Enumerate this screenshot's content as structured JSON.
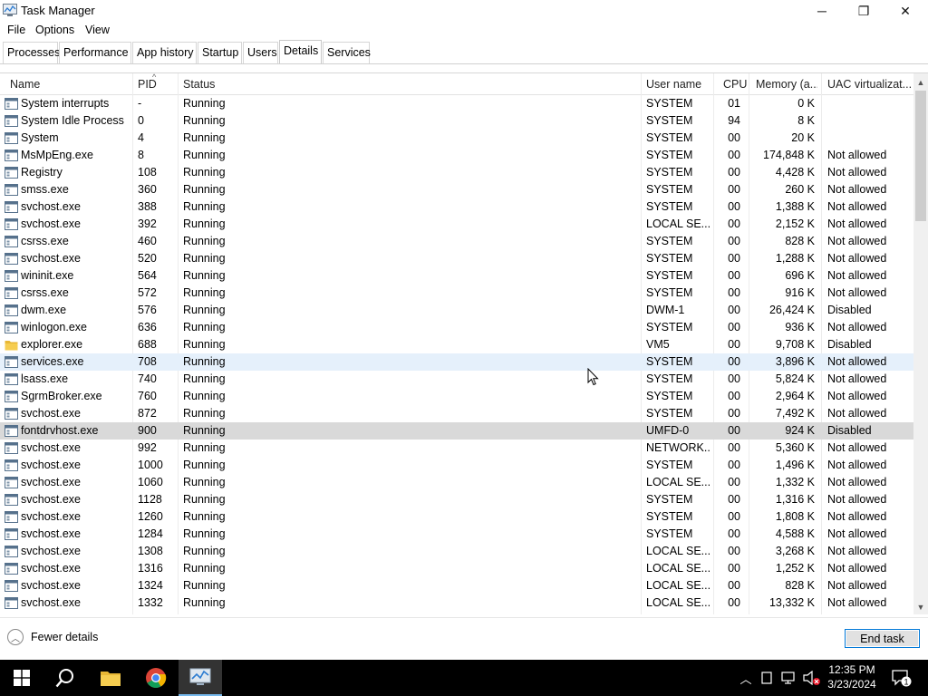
{
  "window": {
    "title": "Task Manager",
    "minimize_label": "─",
    "maximize_label": "❐",
    "close_label": "✕"
  },
  "menu": [
    "File",
    "Options",
    "View"
  ],
  "tabs": [
    {
      "label": "Processes",
      "active": false
    },
    {
      "label": "Performance",
      "active": false
    },
    {
      "label": "App history",
      "active": false
    },
    {
      "label": "Startup",
      "active": false
    },
    {
      "label": "Users",
      "active": false
    },
    {
      "label": "Details",
      "active": true
    },
    {
      "label": "Services",
      "active": false
    }
  ],
  "columns": {
    "name": "Name",
    "pid": "PID",
    "status": "Status",
    "user": "User name",
    "cpu": "CPU",
    "memory": "Memory (a...",
    "uac": "UAC virtualizat...",
    "sort_indicator": "^"
  },
  "rows": [
    {
      "name": "System interrupts",
      "pid": "-",
      "status": "Running",
      "user": "SYSTEM",
      "cpu": "01",
      "memory": "0 K",
      "uac": "",
      "icon": "process-icon"
    },
    {
      "name": "System Idle Process",
      "pid": "0",
      "status": "Running",
      "user": "SYSTEM",
      "cpu": "94",
      "memory": "8 K",
      "uac": "",
      "icon": "process-icon"
    },
    {
      "name": "System",
      "pid": "4",
      "status": "Running",
      "user": "SYSTEM",
      "cpu": "00",
      "memory": "20 K",
      "uac": "",
      "icon": "process-icon"
    },
    {
      "name": "MsMpEng.exe",
      "pid": "8",
      "status": "Running",
      "user": "SYSTEM",
      "cpu": "00",
      "memory": "174,848 K",
      "uac": "Not allowed",
      "icon": "process-icon"
    },
    {
      "name": "Registry",
      "pid": "108",
      "status": "Running",
      "user": "SYSTEM",
      "cpu": "00",
      "memory": "4,428 K",
      "uac": "Not allowed",
      "icon": "process-icon"
    },
    {
      "name": "smss.exe",
      "pid": "360",
      "status": "Running",
      "user": "SYSTEM",
      "cpu": "00",
      "memory": "260 K",
      "uac": "Not allowed",
      "icon": "process-icon"
    },
    {
      "name": "svchost.exe",
      "pid": "388",
      "status": "Running",
      "user": "SYSTEM",
      "cpu": "00",
      "memory": "1,388 K",
      "uac": "Not allowed",
      "icon": "process-icon"
    },
    {
      "name": "svchost.exe",
      "pid": "392",
      "status": "Running",
      "user": "LOCAL SE...",
      "cpu": "00",
      "memory": "2,152 K",
      "uac": "Not allowed",
      "icon": "process-icon"
    },
    {
      "name": "csrss.exe",
      "pid": "460",
      "status": "Running",
      "user": "SYSTEM",
      "cpu": "00",
      "memory": "828 K",
      "uac": "Not allowed",
      "icon": "process-icon"
    },
    {
      "name": "svchost.exe",
      "pid": "520",
      "status": "Running",
      "user": "SYSTEM",
      "cpu": "00",
      "memory": "1,288 K",
      "uac": "Not allowed",
      "icon": "process-icon"
    },
    {
      "name": "wininit.exe",
      "pid": "564",
      "status": "Running",
      "user": "SYSTEM",
      "cpu": "00",
      "memory": "696 K",
      "uac": "Not allowed",
      "icon": "process-icon"
    },
    {
      "name": "csrss.exe",
      "pid": "572",
      "status": "Running",
      "user": "SYSTEM",
      "cpu": "00",
      "memory": "916 K",
      "uac": "Not allowed",
      "icon": "process-icon"
    },
    {
      "name": "dwm.exe",
      "pid": "576",
      "status": "Running",
      "user": "DWM-1",
      "cpu": "00",
      "memory": "26,424 K",
      "uac": "Disabled",
      "icon": "process-icon"
    },
    {
      "name": "winlogon.exe",
      "pid": "636",
      "status": "Running",
      "user": "SYSTEM",
      "cpu": "00",
      "memory": "936 K",
      "uac": "Not allowed",
      "icon": "process-icon"
    },
    {
      "name": "explorer.exe",
      "pid": "688",
      "status": "Running",
      "user": "VM5",
      "cpu": "00",
      "memory": "9,708 K",
      "uac": "Disabled",
      "icon": "folder-icon"
    },
    {
      "name": "services.exe",
      "pid": "708",
      "status": "Running",
      "user": "SYSTEM",
      "cpu": "00",
      "memory": "3,896 K",
      "uac": "Not allowed",
      "icon": "process-icon",
      "state": "hover"
    },
    {
      "name": "lsass.exe",
      "pid": "740",
      "status": "Running",
      "user": "SYSTEM",
      "cpu": "00",
      "memory": "5,824 K",
      "uac": "Not allowed",
      "icon": "process-icon"
    },
    {
      "name": "SgrmBroker.exe",
      "pid": "760",
      "status": "Running",
      "user": "SYSTEM",
      "cpu": "00",
      "memory": "2,964 K",
      "uac": "Not allowed",
      "icon": "process-icon"
    },
    {
      "name": "svchost.exe",
      "pid": "872",
      "status": "Running",
      "user": "SYSTEM",
      "cpu": "00",
      "memory": "7,492 K",
      "uac": "Not allowed",
      "icon": "process-icon"
    },
    {
      "name": "fontdrvhost.exe",
      "pid": "900",
      "status": "Running",
      "user": "UMFD-0",
      "cpu": "00",
      "memory": "924 K",
      "uac": "Disabled",
      "icon": "process-icon",
      "state": "selected"
    },
    {
      "name": "svchost.exe",
      "pid": "992",
      "status": "Running",
      "user": "NETWORK...",
      "cpu": "00",
      "memory": "5,360 K",
      "uac": "Not allowed",
      "icon": "process-icon"
    },
    {
      "name": "svchost.exe",
      "pid": "1000",
      "status": "Running",
      "user": "SYSTEM",
      "cpu": "00",
      "memory": "1,496 K",
      "uac": "Not allowed",
      "icon": "process-icon"
    },
    {
      "name": "svchost.exe",
      "pid": "1060",
      "status": "Running",
      "user": "LOCAL SE...",
      "cpu": "00",
      "memory": "1,332 K",
      "uac": "Not allowed",
      "icon": "process-icon"
    },
    {
      "name": "svchost.exe",
      "pid": "1128",
      "status": "Running",
      "user": "SYSTEM",
      "cpu": "00",
      "memory": "1,316 K",
      "uac": "Not allowed",
      "icon": "process-icon"
    },
    {
      "name": "svchost.exe",
      "pid": "1260",
      "status": "Running",
      "user": "SYSTEM",
      "cpu": "00",
      "memory": "1,808 K",
      "uac": "Not allowed",
      "icon": "process-icon"
    },
    {
      "name": "svchost.exe",
      "pid": "1284",
      "status": "Running",
      "user": "SYSTEM",
      "cpu": "00",
      "memory": "4,588 K",
      "uac": "Not allowed",
      "icon": "process-icon"
    },
    {
      "name": "svchost.exe",
      "pid": "1308",
      "status": "Running",
      "user": "LOCAL SE...",
      "cpu": "00",
      "memory": "3,268 K",
      "uac": "Not allowed",
      "icon": "process-icon"
    },
    {
      "name": "svchost.exe",
      "pid": "1316",
      "status": "Running",
      "user": "LOCAL SE...",
      "cpu": "00",
      "memory": "1,252 K",
      "uac": "Not allowed",
      "icon": "process-icon"
    },
    {
      "name": "svchost.exe",
      "pid": "1324",
      "status": "Running",
      "user": "LOCAL SE...",
      "cpu": "00",
      "memory": "828 K",
      "uac": "Not allowed",
      "icon": "process-icon"
    },
    {
      "name": "svchost.exe",
      "pid": "1332",
      "status": "Running",
      "user": "LOCAL SE...",
      "cpu": "00",
      "memory": "13,332 K",
      "uac": "Not allowed",
      "icon": "process-icon"
    }
  ],
  "footer": {
    "fewer_details": "Fewer details",
    "end_task": "End task"
  },
  "taskbar": {
    "time": "12:35 PM",
    "date": "3/23/2024",
    "notification_count": "1"
  },
  "colors": {
    "accent": "#0078d7",
    "hover_row": "#e5f0fb",
    "selected_row": "#d9d9d9",
    "taskbar": "#000000"
  }
}
